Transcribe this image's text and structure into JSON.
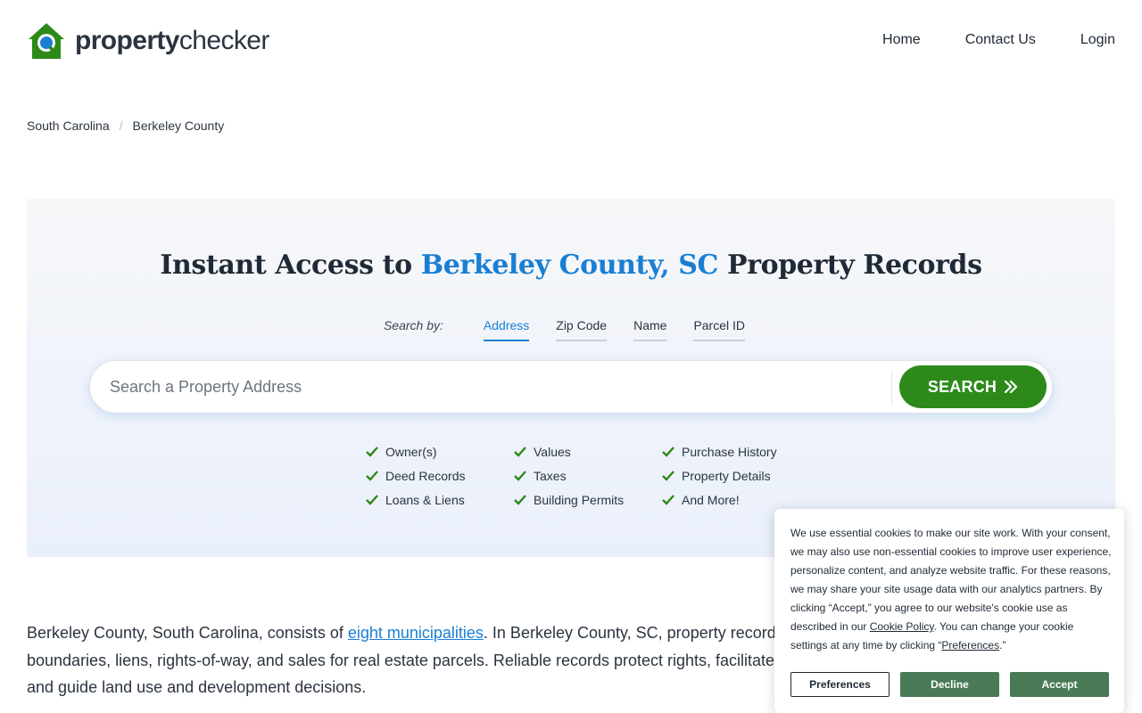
{
  "header": {
    "logo_bold": "property",
    "logo_regular": "checker",
    "nav": [
      {
        "label": "Home"
      },
      {
        "label": "Contact Us"
      },
      {
        "label": "Login"
      }
    ]
  },
  "breadcrumb": {
    "items": [
      "South Carolina",
      "Berkeley County"
    ],
    "separator": "/"
  },
  "hero": {
    "title_pre": "Instant Access to ",
    "title_accent": "Berkeley County, SC",
    "title_post": " Property Records",
    "search_by_label": "Search by:",
    "tabs": [
      {
        "label": "Address",
        "active": true
      },
      {
        "label": "Zip Code",
        "active": false
      },
      {
        "label": "Name",
        "active": false
      },
      {
        "label": "Parcel ID",
        "active": false
      }
    ],
    "search_placeholder": "Search a Property Address",
    "search_button": "SEARCH",
    "features": [
      "Owner(s)",
      "Values",
      "Purchase History",
      "Deed Records",
      "Taxes",
      "Property Details",
      "Loans & Liens",
      "Building Permits",
      "And More!"
    ]
  },
  "body": {
    "p1_pre": "Berkeley County, South Carolina, consists of ",
    "p1_link": "eight municipalities",
    "p1_post": ". In Berkeley County, SC, property records",
    "p1_line2": "boundaries, liens, rights-of-way, and sales for real estate parcels. Reliable records protect rights, facilitate",
    "p1_line3": "and guide land use and development decisions."
  },
  "cookie": {
    "text_1": "We use essential cookies to make our site work. With your consent, we may also use non-essential cookies to improve user experience, personalize content, and analyze website traffic. For these reasons, we may share your site usage data with our analytics partners. By clicking “Accept,” you agree to our website's cookie use as described in our ",
    "link_policy": "Cookie Policy",
    "text_2": ". You can change your cookie settings at any time by clicking “",
    "link_prefs": "Preferences",
    "text_3": ".”",
    "btn_preferences": "Preferences",
    "btn_decline": "Decline",
    "btn_accept": "Accept"
  },
  "colors": {
    "brand_green": "#2d8a1a",
    "accent_blue": "#1a7fd3",
    "cookie_green": "#4a7a55"
  },
  "icons": {
    "logo": "house-magnifier-icon",
    "feature": "checkmark-icon",
    "search_chevron": "double-chevron-right-icon"
  }
}
